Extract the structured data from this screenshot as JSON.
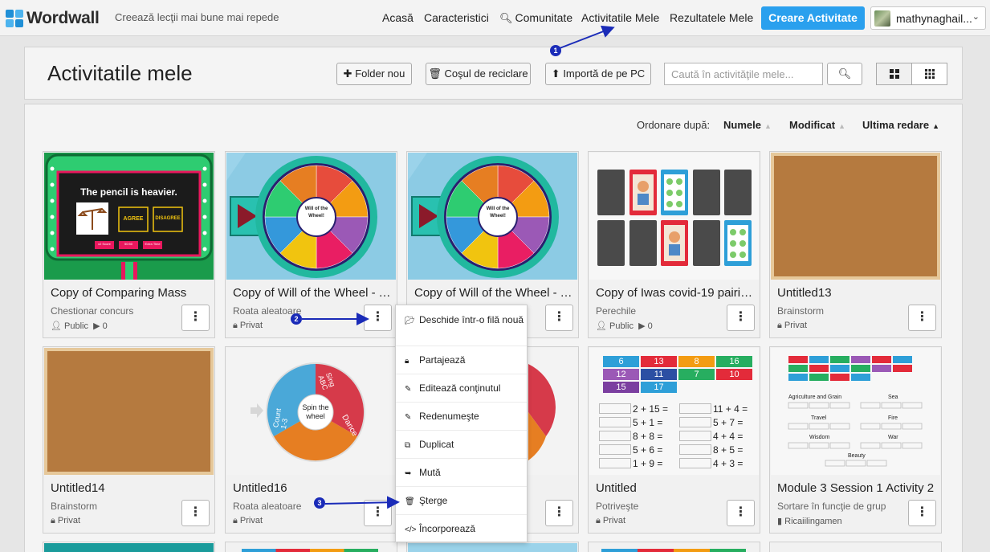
{
  "nav": {
    "logo": "Wordwall",
    "tagline": "Creează lecţii mai bune mai repede",
    "links": [
      "Acasă",
      "Caracteristici",
      "Comunitate",
      "Activitatile Mele",
      "Rezultatele Mele"
    ],
    "create_button": "Creare Activitate",
    "user_name": "mathynaghail..."
  },
  "header": {
    "title": "Activitatile mele",
    "new_folder": "Folder nou",
    "recycle_bin": "Coşul de reciclare",
    "import_pc": "Importă de pe PC",
    "search_placeholder": "Caută în activităţile mele..."
  },
  "sort": {
    "label": "Ordonare după:",
    "options": [
      "Numele",
      "Modificat",
      "Ultima redare"
    ]
  },
  "cards": [
    {
      "title": "Copy of Comparing Mass",
      "type": "Chestionar concurs",
      "meta": "Public",
      "plays": "0"
    },
    {
      "title": "Copy of Will of the Wheel - T...",
      "type": "Roata aleatoare",
      "meta": "Privat",
      "plays": ""
    },
    {
      "title": "Copy of Will of the Wheel - T...",
      "type": "",
      "meta": "",
      "plays": ""
    },
    {
      "title": "Copy of Iwas covid-19 pairin...",
      "type": "Perechile",
      "meta": "Public",
      "plays": "0"
    },
    {
      "title": "Untitled13",
      "type": "Brainstorm",
      "meta": "Privat",
      "plays": ""
    },
    {
      "title": "Untitled14",
      "type": "Brainstorm",
      "meta": "Privat",
      "plays": ""
    },
    {
      "title": "Untitled16",
      "type": "Roata aleatoare",
      "meta": "Privat",
      "plays": ""
    },
    {
      "title": "",
      "type": "",
      "meta": "",
      "plays": ""
    },
    {
      "title": "Untitled",
      "type": "Potriveşte",
      "meta": "Privat",
      "plays": ""
    },
    {
      "title": "Module 3 Session 1 Activity 2",
      "type": "Sortare în funcţie de grup",
      "meta": "Ricaiilingamen",
      "plays": ""
    }
  ],
  "thumbs": {
    "quiz_question": "The pencil is heavier.",
    "quiz_agree": "AGREE",
    "quiz_disagree": "DISAGREE",
    "quiz_small": [
      "x2 Score",
      "50:50",
      "Extra Time"
    ],
    "wheel_center": "Will of the Wheel!",
    "spin_center": "Spin the wheel",
    "spin_segments": [
      "Sing ABC",
      "Count 1-3",
      "Dance"
    ],
    "match_top": [
      "6",
      "13",
      "8",
      "16",
      "12",
      "11",
      "7",
      "10",
      "15",
      "17"
    ],
    "match_left": [
      "2 + 15 =",
      "5 + 1 =",
      "8 + 8 =",
      "5 + 6 =",
      "1 + 9 ="
    ],
    "match_right": [
      "11 + 4 =",
      "5 + 7 =",
      "4 + 4 =",
      "8 + 5 =",
      "4 + 3 ="
    ],
    "group_labels": [
      "Agriculture and Grain",
      "Sea",
      "Travel",
      "Fire",
      "Wisdom",
      "War",
      "Beauty"
    ]
  },
  "menu": {
    "items": [
      "Deschide într-o filă nouă",
      "Partajează",
      "Editează conţinutul",
      "Redenumeşte",
      "Duplicat",
      "Mută",
      "Şterge",
      "Încorporează"
    ]
  },
  "annotations": [
    "1",
    "2",
    "3"
  ],
  "colors": {
    "accent": "#2aa0ee",
    "annotation": "#1a2bb8"
  }
}
